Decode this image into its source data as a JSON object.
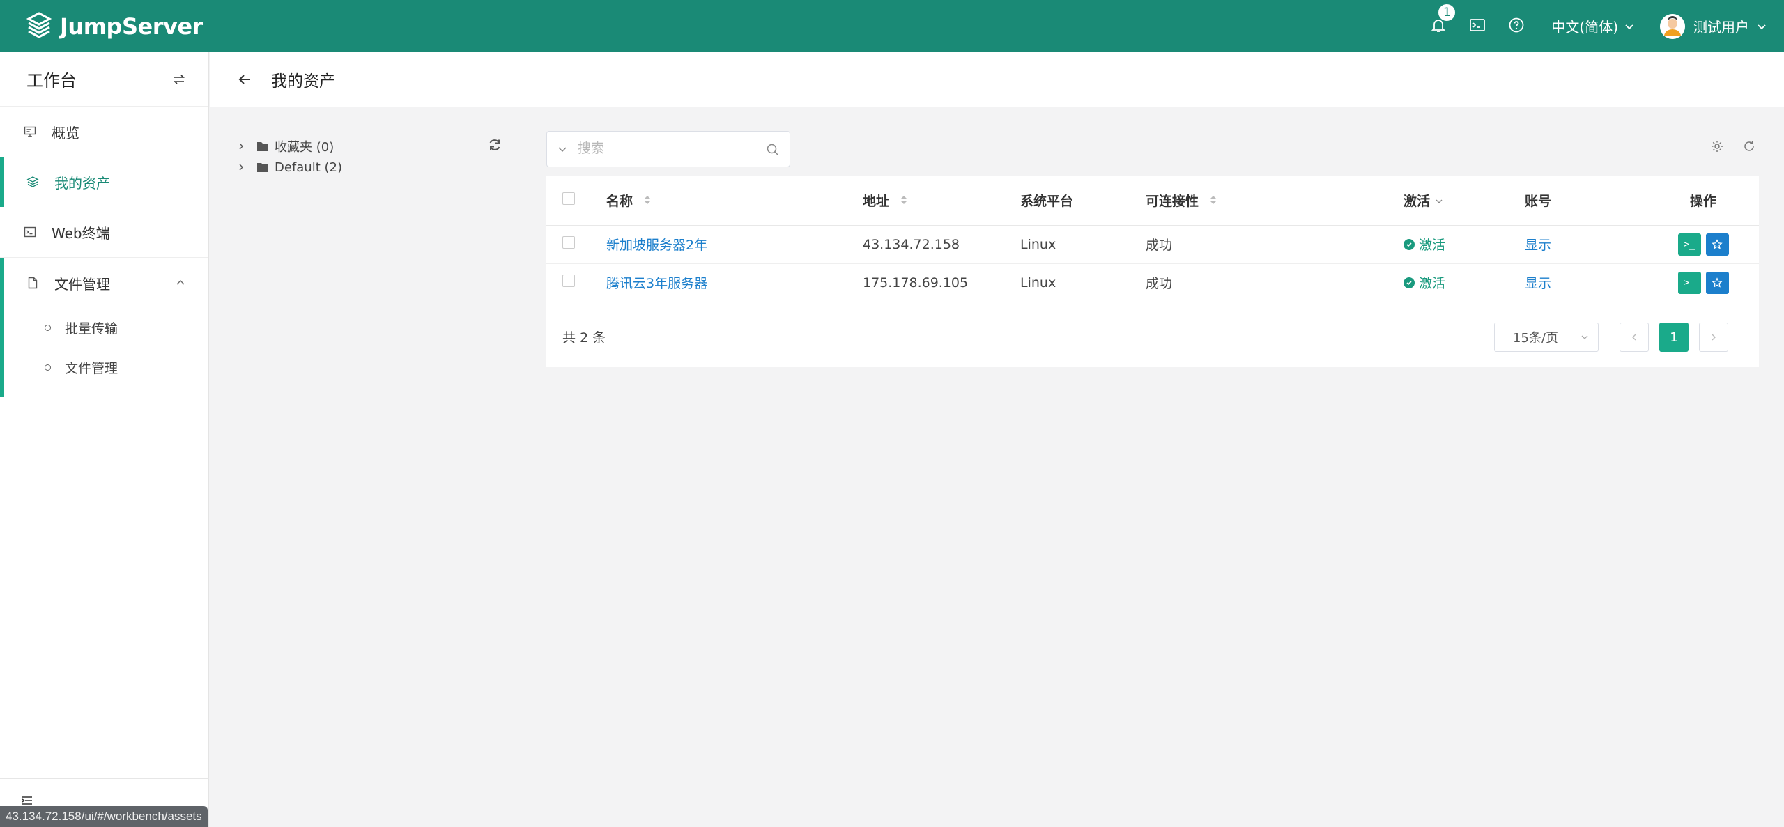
{
  "header": {
    "brand": "JumpServer",
    "notification_count": "1",
    "language": "中文(简体)",
    "username": "测试用户",
    "icons": [
      "logo-icon",
      "bell-icon",
      "terminal-icon",
      "help-icon",
      "avatar",
      "chevron-down-icon"
    ],
    "accent_color": "#1a8a76"
  },
  "sidebar": {
    "title": "工作台",
    "items": [
      {
        "label": "概览",
        "icon": "monitor-icon"
      },
      {
        "label": "我的资产",
        "icon": "layers-icon",
        "active": true
      },
      {
        "label": "Web终端",
        "icon": "terminal-icon"
      },
      {
        "label": "文件管理",
        "icon": "file-icon",
        "expanded": true
      }
    ],
    "subitems": [
      {
        "label": "批量传输"
      },
      {
        "label": "文件管理"
      }
    ]
  },
  "page": {
    "title": "我的资产"
  },
  "tree": {
    "nodes": [
      {
        "label": "收藏夹 (0)"
      },
      {
        "label": "Default (2)"
      }
    ]
  },
  "search": {
    "placeholder": "搜索"
  },
  "table": {
    "columns": [
      "名称",
      "地址",
      "系统平台",
      "可连接性",
      "激活",
      "账号",
      "操作"
    ],
    "rows": [
      {
        "name": "新加坡服务器2年",
        "address": "43.134.72.158",
        "platform": "Linux",
        "connectivity": "成功",
        "active": "激活",
        "account": "显示"
      },
      {
        "name": "腾讯云3年服务器",
        "address": "175.178.69.105",
        "platform": "Linux",
        "connectivity": "成功",
        "active": "激活",
        "account": "显示"
      }
    ],
    "total": "共 2 条",
    "page_size": "15条/页",
    "current_page": "1"
  },
  "statusbar": {
    "url": "43.134.72.158/ui/#/workbench/assets"
  }
}
